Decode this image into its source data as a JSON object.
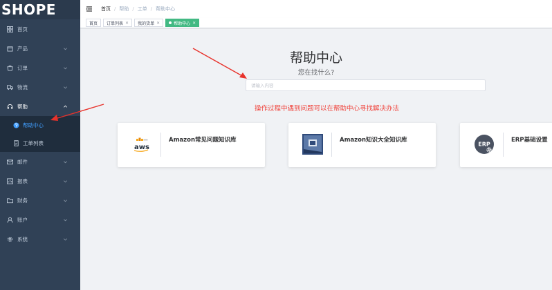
{
  "app": {
    "logo_text": "SHOPE"
  },
  "sidebar": {
    "items": [
      {
        "label": "首页",
        "icon": "dashboard-icon",
        "has_children": false
      },
      {
        "label": "产品",
        "icon": "product-icon",
        "has_children": true
      },
      {
        "label": "订单",
        "icon": "order-icon",
        "has_children": true
      },
      {
        "label": "物流",
        "icon": "truck-icon",
        "has_children": true
      },
      {
        "label": "帮助",
        "icon": "headset-icon",
        "has_children": true,
        "open": true,
        "children": [
          {
            "label": "帮助中心",
            "icon": "question-icon",
            "active": true
          },
          {
            "label": "工单列表",
            "icon": "ticket-icon",
            "active": false
          }
        ]
      },
      {
        "label": "邮件",
        "icon": "mail-icon",
        "has_children": true
      },
      {
        "label": "报表",
        "icon": "report-icon",
        "has_children": true
      },
      {
        "label": "财务",
        "icon": "folder-icon",
        "has_children": true
      },
      {
        "label": "账户",
        "icon": "user-icon",
        "has_children": true
      },
      {
        "label": "系统",
        "icon": "gear-icon",
        "has_children": true
      }
    ]
  },
  "breadcrumb": [
    "首页",
    "帮助",
    "工单",
    "帮助中心"
  ],
  "tags": [
    {
      "label": "首页",
      "closable": false,
      "active": false
    },
    {
      "label": "订单列表",
      "closable": true,
      "active": false
    },
    {
      "label": "我的货单",
      "closable": true,
      "active": false
    },
    {
      "label": "帮助中心",
      "closable": true,
      "active": true
    }
  ],
  "main": {
    "title": "帮助中心",
    "subtitle": "您在找什么?",
    "search": {
      "placeholder": "请输入内容",
      "value": ""
    },
    "hint": "操作过程中遇到问题可以在帮助中心寻找解决办法",
    "cards": [
      {
        "title": "Amazon常见问题知识库",
        "logo": "aws-logo"
      },
      {
        "title": "Amazon知识大全知识库",
        "logo": "erp-book-logo"
      },
      {
        "title": "ERP基础设置",
        "logo": "erp-gear-logo",
        "logo_text": "ERP"
      }
    ]
  },
  "colors": {
    "sidebar_bg": "#304156",
    "sidebar_active_text": "#409eff",
    "active_tag": "#42b983",
    "hint_red": "#f0433b",
    "arrow_red": "#e8322b"
  }
}
